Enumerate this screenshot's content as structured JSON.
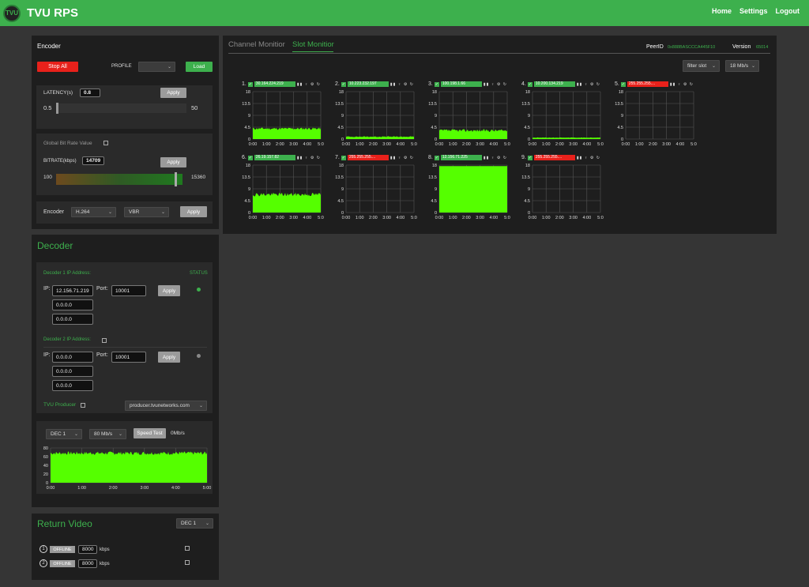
{
  "header": {
    "logo_text": "TVU",
    "app_title": "TVU RPS",
    "nav": [
      "Home",
      "Settings",
      "Logout"
    ]
  },
  "encoder": {
    "title": "Encoder",
    "stop_all": "Stop All",
    "profile_label": "PROFILE",
    "profile_value": "",
    "load": "Load",
    "latency_label": "LATENCY(s)",
    "latency_value": "0.8",
    "latency_min": "0.5",
    "latency_max": "50",
    "latency_level": 0.0,
    "apply": "Apply",
    "global_bitrate_label": "Global Bit Rate Value",
    "bitrate_label": "BITRATE(kbps)",
    "bitrate_value": "14709",
    "bitrate_min": "100",
    "bitrate_max": "15360",
    "bitrate_level": 0.957,
    "encoder_label": "Encoder",
    "codec": "H.264",
    "rate_mode": "VBR"
  },
  "decoder": {
    "title": "Decoder",
    "dec1_label": "Decoder 1 IP Address:",
    "status_label": "STATUS",
    "ip_label": "IP:",
    "port_label": "Port:",
    "dec1_ips": [
      "12.156.71.219",
      "0.0.0.0",
      "0.0.0.0"
    ],
    "dec1_port": "10001",
    "dec2_label": "Decoder 2 IP Address:",
    "dec2_ips": [
      "0.0.0.0",
      "0.0.0.0",
      "0.0.0.0"
    ],
    "dec2_port": "10001",
    "apply": "Apply",
    "producer_label": "TVU Producer",
    "producer_value": "producer.tvunetworks.com",
    "status_colors": [
      "#3db04d",
      "#888888"
    ]
  },
  "speed": {
    "dec_select": "DEC 1",
    "rate_select": "80 Mb/s",
    "speed_test": "Speed Test",
    "rate_readout": "0Mb/s",
    "y_ticks": [
      "80",
      "60",
      "40",
      "20",
      "0"
    ],
    "x_ticks": [
      "0:00",
      "1:00",
      "2:00",
      "3:00",
      "4:00",
      "5:00"
    ]
  },
  "return_video": {
    "title": "Return Video",
    "dec_select": "DEC 1",
    "rows": [
      {
        "num": "1",
        "status": "OFFLINE",
        "kbps": "8000",
        "unit": "kbps"
      },
      {
        "num": "2",
        "status": "OFFLINE",
        "kbps": "8000",
        "unit": "kbps"
      }
    ]
  },
  "monitor": {
    "tabs": [
      "Channel Monitior",
      "Slot Monitior"
    ],
    "peer_label": "PeerID",
    "peer_value": "0x888BASCCCA445F10",
    "version_label": "Version",
    "version_value": "65014",
    "filter_slot": "filter slot",
    "rate_select": "18 Mb/s",
    "slot_y_ticks": [
      "18",
      "13.5",
      "9",
      "4.5",
      "0"
    ],
    "slot_x_ticks": [
      "0:00",
      "1:00",
      "2:00",
      "3:00",
      "4:00",
      "5:0"
    ],
    "slot_icons": "▮▮ ♀ ⚙ ↻",
    "slots": [
      {
        "num": "1.",
        "ip": "30.164.224.219",
        "status": "green",
        "level": 0.22,
        "noise": 0.05
      },
      {
        "num": "2.",
        "ip": "10.223.232.197",
        "status": "green",
        "level": 0.05,
        "noise": 0.02
      },
      {
        "num": "3.",
        "ip": "100.198.1.66",
        "status": "green",
        "level": 0.18,
        "noise": 0.06
      },
      {
        "num": "4.",
        "ip": "10.200.134.219",
        "status": "green",
        "level": 0.03,
        "noise": 0.01
      },
      {
        "num": "5.",
        "ip": "255.255.255....",
        "status": "red",
        "level": 0,
        "noise": 0
      },
      {
        "num": "6.",
        "ip": "26.19.157.82",
        "status": "green",
        "level": 0.38,
        "noise": 0.08
      },
      {
        "num": "7.",
        "ip": "255.255.255....",
        "status": "red",
        "level": 0,
        "noise": 0
      },
      {
        "num": "8.",
        "ip": "12.156.71.225",
        "status": "green",
        "level": 0.98,
        "noise": 0
      },
      {
        "num": "9.",
        "ip": "255.255.255....",
        "status": "red",
        "level": 0,
        "noise": 0
      }
    ]
  },
  "colors": {
    "accent": "#3db04d",
    "fill": "#55ff00",
    "red": "#e8211b"
  }
}
